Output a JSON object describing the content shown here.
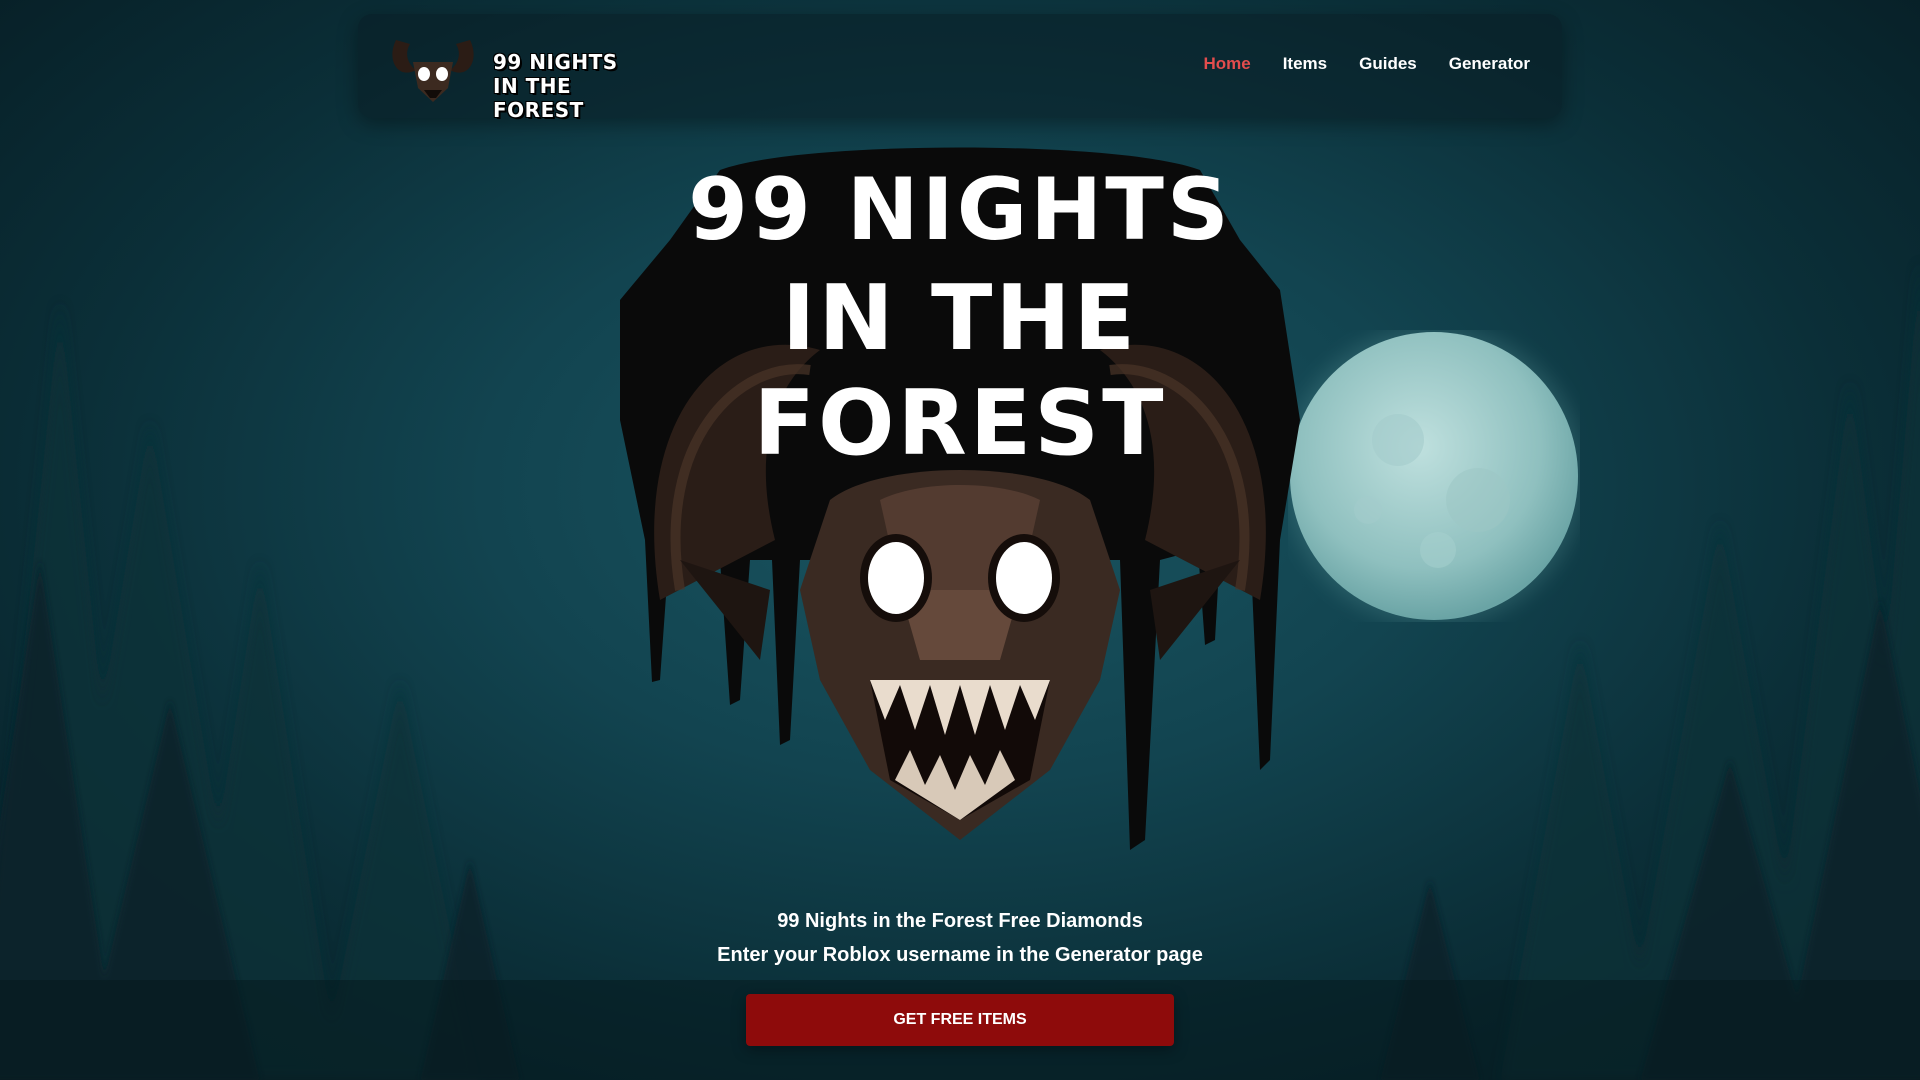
{
  "nav": {
    "logo_line1": "99 NIGHTS",
    "logo_line2": "IN THE FOREST",
    "links": [
      {
        "label": "Home",
        "active": true
      },
      {
        "label": "Items",
        "active": false
      },
      {
        "label": "Guides",
        "active": false
      },
      {
        "label": "Generator",
        "active": false
      }
    ]
  },
  "hero": {
    "title_line1": "99 NIGHTS",
    "title_line2": "IN THE FOREST",
    "tagline1": "99 Nights in the Forest Free Diamonds",
    "tagline2": "Enter your Roblox username in the Generator page",
    "cta_label": "GET FREE ITEMS"
  },
  "colors": {
    "accent": "#e24d4d",
    "cta": "#8e0b0b",
    "background": "#124450"
  }
}
